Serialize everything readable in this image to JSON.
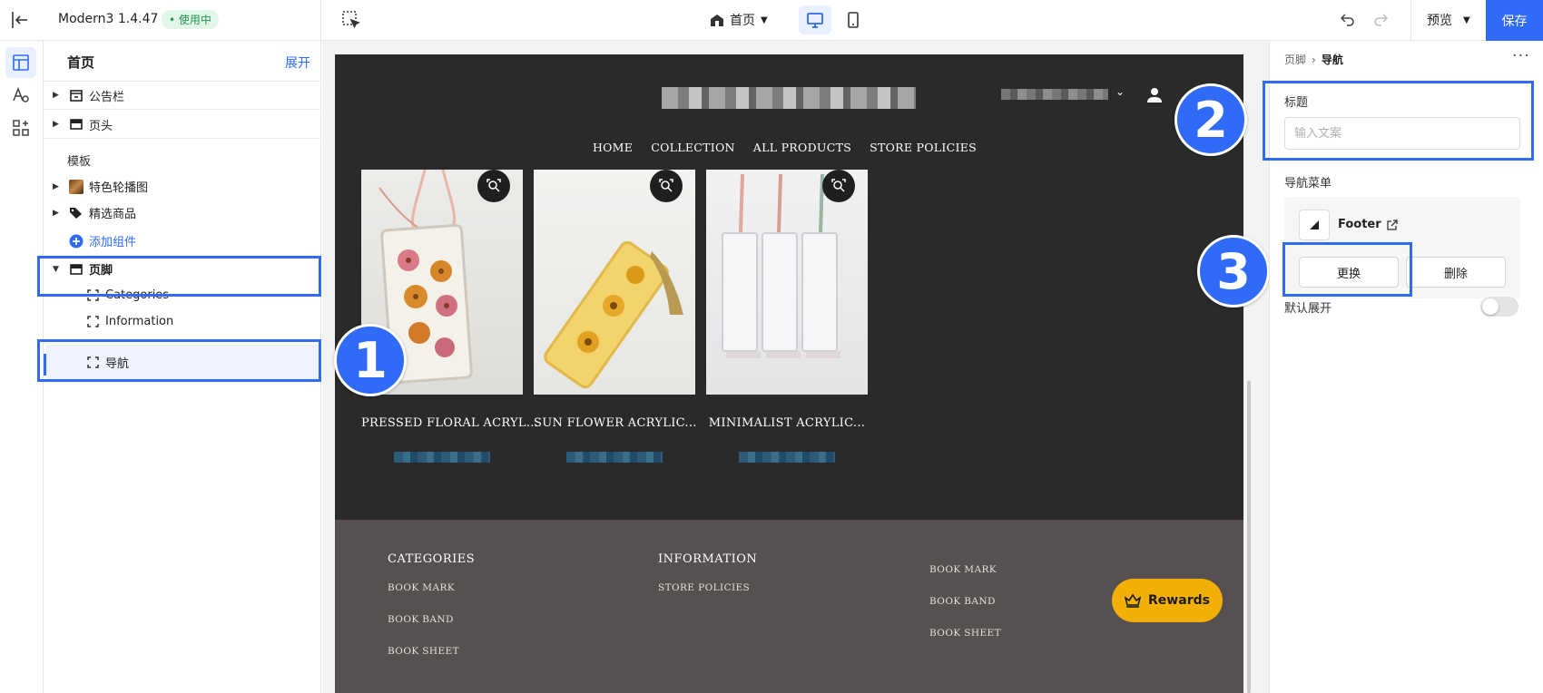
{
  "topbar": {
    "theme_name": "Modern3  1.4.47",
    "theme_status": "• 使用中",
    "page_selector": "首页",
    "preview": "预览",
    "save": "保存"
  },
  "tree": {
    "title": "首页",
    "expand": "展开",
    "items": [
      {
        "label": "公告栏",
        "icon": "announcement-icon"
      },
      {
        "label": "页头",
        "icon": "header-icon"
      }
    ],
    "section_label": "模板",
    "template_items": [
      {
        "label": "特色轮播图",
        "icon": "image-thumbnail"
      },
      {
        "label": "精选商品",
        "icon": "tag-icon"
      }
    ],
    "add_component": "添加组件",
    "footer": {
      "label": "页脚",
      "children": [
        "Categories",
        "Information",
        "导航"
      ]
    }
  },
  "site": {
    "nav": [
      "HOME",
      "COLLECTION",
      "ALL PRODUCTS",
      "STORE POLICIES"
    ],
    "products": [
      {
        "name": "PRESSED FLORAL ACRYL..."
      },
      {
        "name": "SUN FLOWER ACRYLIC..."
      },
      {
        "name": "MINIMALIST ACRYLIC..."
      }
    ],
    "footer": {
      "col1": {
        "heading": "CATEGORIES",
        "links": [
          "BOOK MARK",
          "BOOK BAND",
          "BOOK SHEET"
        ]
      },
      "col2": {
        "heading": "INFORMATION",
        "links": [
          "STORE POLICIES"
        ]
      },
      "col3": {
        "links": [
          "BOOK MARK",
          "BOOK BAND",
          "BOOK SHEET"
        ]
      },
      "rewards": "Rewards"
    }
  },
  "badges": [
    "1",
    "2",
    "3"
  ],
  "panel": {
    "breadcrumb_parent": "页脚",
    "breadcrumb_sep": "›",
    "breadcrumb_current": "导航",
    "more": "···",
    "title_label": "标题",
    "title_placeholder": "输入文案",
    "menu_label": "导航菜单",
    "menu_name": "Footer",
    "replace": "更换",
    "delete": "删除",
    "default_expand": "默认展开",
    "default_expand_on": false
  },
  "colors": {
    "accent": "#2f6bf6",
    "site_bg": "#2a2a2a",
    "footer_bg": "#565150",
    "rewards": "#f2b007"
  }
}
